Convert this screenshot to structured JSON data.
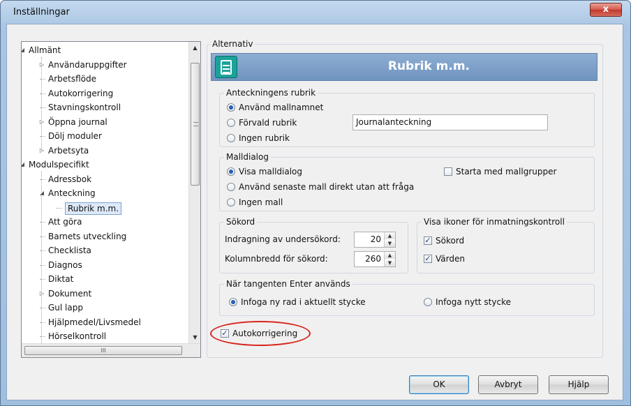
{
  "window": {
    "title": "Inställningar",
    "close_glyph": "x"
  },
  "tree": {
    "items": [
      {
        "label": "Allmänt",
        "level": 0,
        "expander": "expanded"
      },
      {
        "label": "Användaruppgifter",
        "level": 1,
        "expander": "collapsed"
      },
      {
        "label": "Arbetsflöde",
        "level": 1,
        "expander": "none"
      },
      {
        "label": "Autokorrigering",
        "level": 1,
        "expander": "none"
      },
      {
        "label": "Stavningskontroll",
        "level": 1,
        "expander": "none"
      },
      {
        "label": "Öppna journal",
        "level": 1,
        "expander": "collapsed"
      },
      {
        "label": "Dölj moduler",
        "level": 1,
        "expander": "none"
      },
      {
        "label": "Arbetsyta",
        "level": 1,
        "expander": "collapsed"
      },
      {
        "label": "Modulspecifikt",
        "level": 0,
        "expander": "expanded"
      },
      {
        "label": "Adressbok",
        "level": 1,
        "expander": "none"
      },
      {
        "label": "Anteckning",
        "level": 1,
        "expander": "expanded"
      },
      {
        "label": "Rubrik m.m.",
        "level": 2,
        "expander": "none",
        "selected": true
      },
      {
        "label": "Att göra",
        "level": 1,
        "expander": "none"
      },
      {
        "label": "Barnets utveckling",
        "level": 1,
        "expander": "none"
      },
      {
        "label": "Checklista",
        "level": 1,
        "expander": "none"
      },
      {
        "label": "Diagnos",
        "level": 1,
        "expander": "none"
      },
      {
        "label": "Diktat",
        "level": 1,
        "expander": "none"
      },
      {
        "label": "Dokument",
        "level": 1,
        "expander": "collapsed"
      },
      {
        "label": "Gul lapp",
        "level": 1,
        "expander": "none"
      },
      {
        "label": "Hjälpmedel/Livsmedel",
        "level": 1,
        "expander": "none"
      },
      {
        "label": "Hörselkontroll",
        "level": 1,
        "expander": "none"
      }
    ],
    "hscroll_grip": "III"
  },
  "alternativ": {
    "legend": "Alternativ",
    "banner_title": "Rubrik m.m.",
    "banner_icon": "notepad-icon"
  },
  "rubrik_group": {
    "legend": "Anteckningens rubrik",
    "options": [
      {
        "label": "Använd mallnamnet",
        "checked": true
      },
      {
        "label": "Förvald rubrik",
        "checked": false
      },
      {
        "label": "Ingen rubrik",
        "checked": false
      }
    ],
    "default_heading_value": "Journalanteckning"
  },
  "malldialog_group": {
    "legend": "Malldialog",
    "options": [
      {
        "label": "Visa malldialog",
        "checked": true
      },
      {
        "label": "Använd senaste mall direkt utan att fråga",
        "checked": false
      },
      {
        "label": "Ingen mall",
        "checked": false
      }
    ],
    "start_with_groups_label": "Starta med mallgrupper",
    "start_with_groups_checked": false
  },
  "sokord_group": {
    "legend": "Sökord",
    "indent_label": "Indragning av undersökord:",
    "indent_value": "20",
    "width_label": "Kolumnbredd för sökord:",
    "width_value": "260"
  },
  "ikoner_group": {
    "legend": "Visa ikoner för inmatningskontroll",
    "sokord_label": "Sökord",
    "sokord_checked": true,
    "varden_label": "Värden",
    "varden_checked": true
  },
  "enter_group": {
    "legend": "När tangenten Enter används",
    "option_new_row": "Infoga ny rad i aktuellt stycke",
    "option_new_row_checked": true,
    "option_new_paragraph": "Infoga nytt stycke",
    "option_new_paragraph_checked": false
  },
  "autocorrect": {
    "label": "Autokorrigering",
    "checked": true
  },
  "buttons": {
    "ok": "OK",
    "cancel": "Avbryt",
    "help": "Hjälp"
  },
  "check_glyph": "✓"
}
